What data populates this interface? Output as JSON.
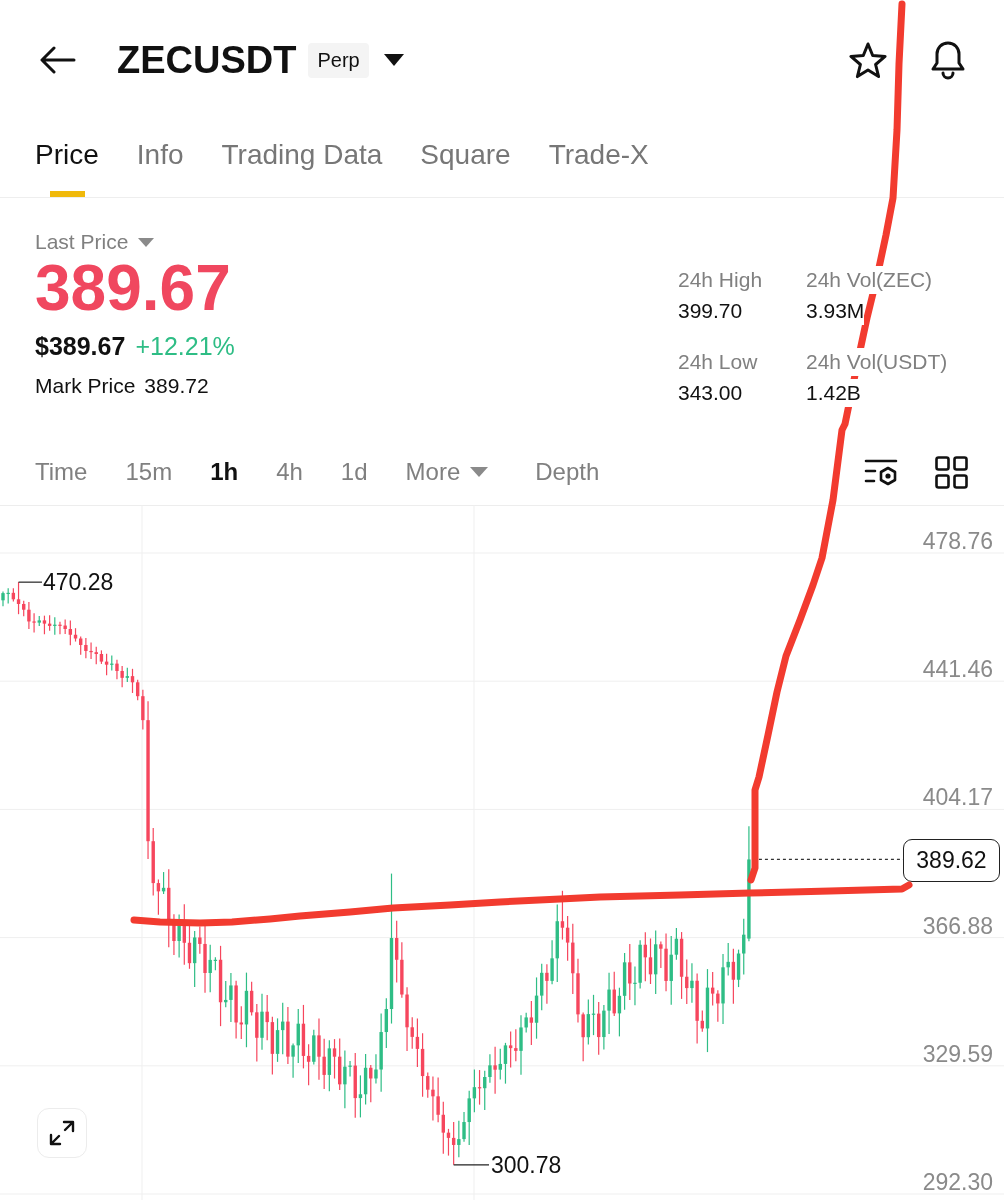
{
  "header": {
    "title": "ZECUSDT",
    "badge": "Perp"
  },
  "tabs": [
    {
      "label": "Price",
      "selected": true
    },
    {
      "label": "Info",
      "selected": false
    },
    {
      "label": "Trading Data",
      "selected": false
    },
    {
      "label": "Square",
      "selected": false
    },
    {
      "label": "Trade-X",
      "selected": false
    }
  ],
  "price": {
    "label": "Last Price",
    "last_price": "389.67",
    "usd_price": "$389.67",
    "change": "+12.21%",
    "mark_price_label": "Mark Price",
    "mark_price": "389.72"
  },
  "stats": [
    {
      "label": "24h High",
      "value": "399.70"
    },
    {
      "label": "24h Vol(ZEC)",
      "value": "3.93M"
    },
    {
      "label": "24h Low",
      "value": "343.00"
    },
    {
      "label": "24h Vol(USDT)",
      "value": "1.42B"
    }
  ],
  "intervals": [
    {
      "label": "Time",
      "kind": "interval",
      "selected": false
    },
    {
      "label": "15m",
      "kind": "interval",
      "selected": false
    },
    {
      "label": "1h",
      "kind": "interval",
      "selected": true
    },
    {
      "label": "4h",
      "kind": "interval",
      "selected": false
    },
    {
      "label": "1d",
      "kind": "interval",
      "selected": false
    },
    {
      "label": "More",
      "kind": "dropdown",
      "selected": false
    },
    {
      "label": "Depth",
      "kind": "view",
      "selected": false
    }
  ],
  "chart": {
    "price_scale": [
      "478.76",
      "441.46",
      "404.17",
      "366.88",
      "329.59",
      "292.30"
    ],
    "high_marker": "470.28",
    "low_marker": "300.78",
    "current_price": "389.62"
  }
}
